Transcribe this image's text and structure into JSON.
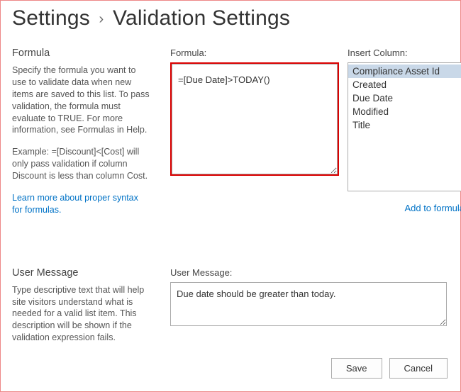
{
  "breadcrumb": {
    "root": "Settings",
    "sep": "›",
    "page": "Validation Settings"
  },
  "formula_section": {
    "heading": "Formula",
    "desc": "Specify the formula you want to use to validate data when new items are saved to this list. To pass validation, the formula must evaluate to TRUE. For more information, see Formulas in Help.",
    "example": "Example: =[Discount]<[Cost] will only pass validation if column Discount is less than column Cost.",
    "learn_link": "Learn more about proper syntax for formulas.",
    "field_label": "Formula:",
    "value": "=[Due Date]>TODAY()"
  },
  "insert_column": {
    "label": "Insert Column:",
    "items": [
      "Compliance Asset Id",
      "Created",
      "Due Date",
      "Modified",
      "Title"
    ],
    "selected_index": 0,
    "add_link": "Add to formula"
  },
  "user_message_section": {
    "heading": "User Message",
    "desc": "Type descriptive text that will help site visitors understand what is needed for a valid list item. This description will be shown if the validation expression fails.",
    "field_label": "User Message:",
    "value": "Due date should be greater than today."
  },
  "buttons": {
    "save": "Save",
    "cancel": "Cancel"
  }
}
